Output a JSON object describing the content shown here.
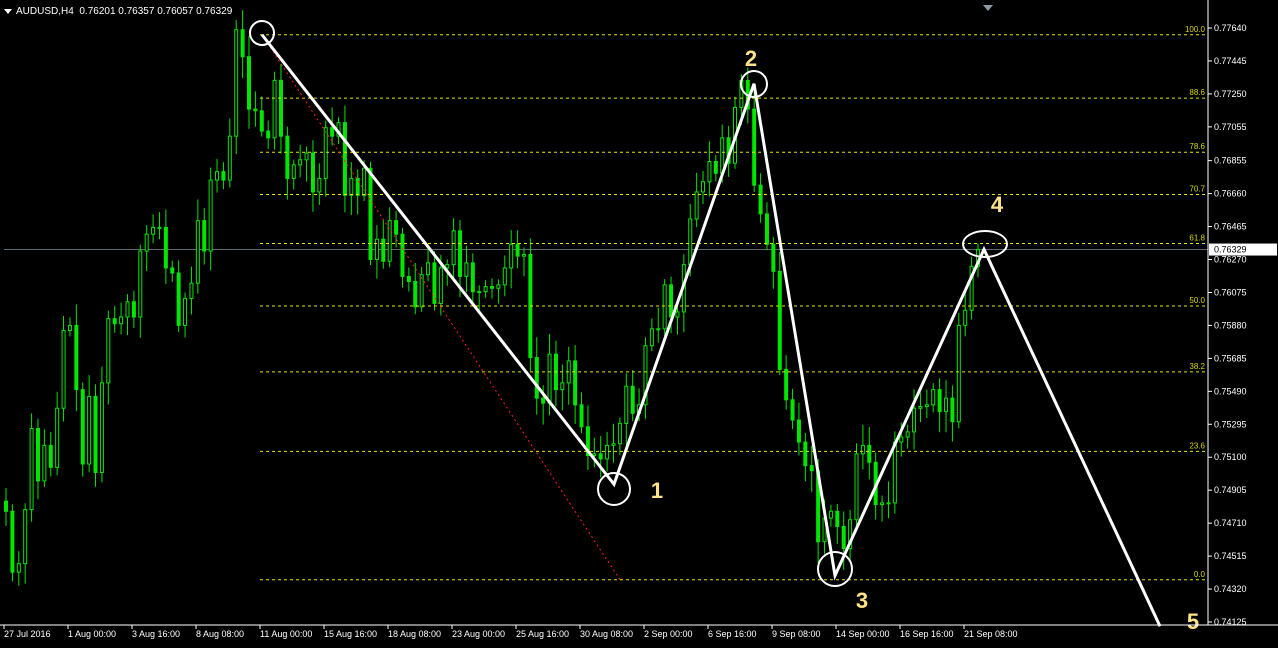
{
  "header": {
    "symbol": "AUDUSD,H4",
    "ohlc": "0.76201 0.76357 0.76057 0.76329"
  },
  "colors": {
    "background": "#000000",
    "candles": "#00e600",
    "fib_lines": "#e6e600",
    "fib_labels": "#d8d800",
    "wave_lines": "#ffffff",
    "wave_numbers": "#ffe28a",
    "trend_dotted": "#ff2020",
    "current_price_bg": "#ffffff"
  },
  "chart_data": {
    "type": "candlestick",
    "price_axis_ticks": [
      "0.77640",
      "0.77445",
      "0.77250",
      "0.77055",
      "0.76855",
      "0.76660",
      "0.76465",
      "0.76270",
      "0.76075",
      "0.75880",
      "0.75685",
      "0.75490",
      "0.75295",
      "0.75100",
      "0.74905",
      "0.74710",
      "0.74515",
      "0.74320",
      "0.74125"
    ],
    "current_price": "0.76329",
    "ylim": [
      0.741,
      0.7785
    ],
    "time_axis_labels": [
      "27 Jul 2016",
      "1 Aug 00:00",
      "3 Aug 16:00",
      "8 Aug 08:00",
      "11 Aug 00:00",
      "15 Aug 16:00",
      "18 Aug 08:00",
      "23 Aug 00:00",
      "25 Aug 16:00",
      "30 Aug 08:00",
      "2 Sep 00:00",
      "6 Sep 16:00",
      "9 Sep 08:00",
      "14 Sep 00:00",
      "16 Sep 16:00",
      "21 Sep 08:00"
    ],
    "fib_levels": [
      {
        "label": "100.0",
        "price": 0.776
      },
      {
        "label": "88.6",
        "price": 0.77225
      },
      {
        "label": "78.6",
        "price": 0.76905
      },
      {
        "label": "70.7",
        "price": 0.76655
      },
      {
        "label": "61.8",
        "price": 0.76365
      },
      {
        "label": "50.0",
        "price": 0.75995
      },
      {
        "label": "38.2",
        "price": 0.75605
      },
      {
        "label": "23.6",
        "price": 0.75135
      },
      {
        "label": "0.0",
        "price": 0.74375
      }
    ],
    "wave_points": [
      {
        "label": "",
        "price": 0.776
      },
      {
        "label": "1",
        "price": 0.7494
      },
      {
        "label": "2",
        "price": 0.7731
      },
      {
        "label": "3",
        "price": 0.744
      },
      {
        "label": "4",
        "price": 0.7633
      },
      {
        "label": "5",
        "price": 0.741
      }
    ],
    "bars": [
      0.7478,
      0.7442,
      0.7447,
      0.7479,
      0.7527,
      0.7496,
      0.7517,
      0.7504,
      0.7539,
      0.7585,
      0.7588,
      0.755,
      0.7506,
      0.7546,
      0.7501,
      0.7554,
      0.7592,
      0.7589,
      0.7593,
      0.7602,
      0.7593,
      0.7632,
      0.7642,
      0.7646,
      0.7646,
      0.7622,
      0.7619,
      0.7588,
      0.7604,
      0.7613,
      0.765,
      0.7632,
      0.7674,
      0.7679,
      0.7674,
      0.77,
      0.7763,
      0.7747,
      0.7716,
      0.7715,
      0.7703,
      0.7699,
      0.7733,
      0.77,
      0.7675,
      0.7683,
      0.7686,
      0.769,
      0.7667,
      0.7675,
      0.7705,
      0.77,
      0.7708,
      0.7665,
      0.7675,
      0.7665,
      0.7681,
      0.7627,
      0.7639,
      0.7626,
      0.765,
      0.7642,
      0.7617,
      0.7614,
      0.7599,
      0.7618,
      0.7625,
      0.7601,
      0.7622,
      0.7624,
      0.7644,
      0.7617,
      0.7625,
      0.7608,
      0.7608,
      0.7611,
      0.761,
      0.7612,
      0.7622,
      0.7636,
      0.7629,
      0.763,
      0.7569,
      0.7545,
      0.7542,
      0.7571,
      0.755,
      0.7554,
      0.7567,
      0.7541,
      0.7528,
      0.7511,
      0.7512,
      0.7509,
      0.7517,
      0.7518,
      0.753,
      0.7552,
      0.7536,
      0.7541,
      0.7576,
      0.7586,
      0.7586,
      0.7612,
      0.7593,
      0.7596,
      0.7624,
      0.7651,
      0.7667,
      0.7673,
      0.7685,
      0.7678,
      0.7699,
      0.7684,
      0.7717,
      0.7733,
      0.7716,
      0.7671,
      0.7654,
      0.7636,
      0.762,
      0.7562,
      0.7544,
      0.7532,
      0.7519,
      0.7505,
      0.7502,
      0.746,
      0.7474,
      0.7478,
      0.7469,
      0.7456,
      0.7473,
      0.7512,
      0.7517,
      0.7507,
      0.7482,
      0.7483,
      0.7483,
      0.7519,
      0.7522,
      0.7525,
      0.7539,
      0.754,
      0.7541,
      0.755,
      0.7537,
      0.7545,
      0.7531,
      0.7588,
      0.7597,
      0.7623,
      0.7633
    ]
  }
}
